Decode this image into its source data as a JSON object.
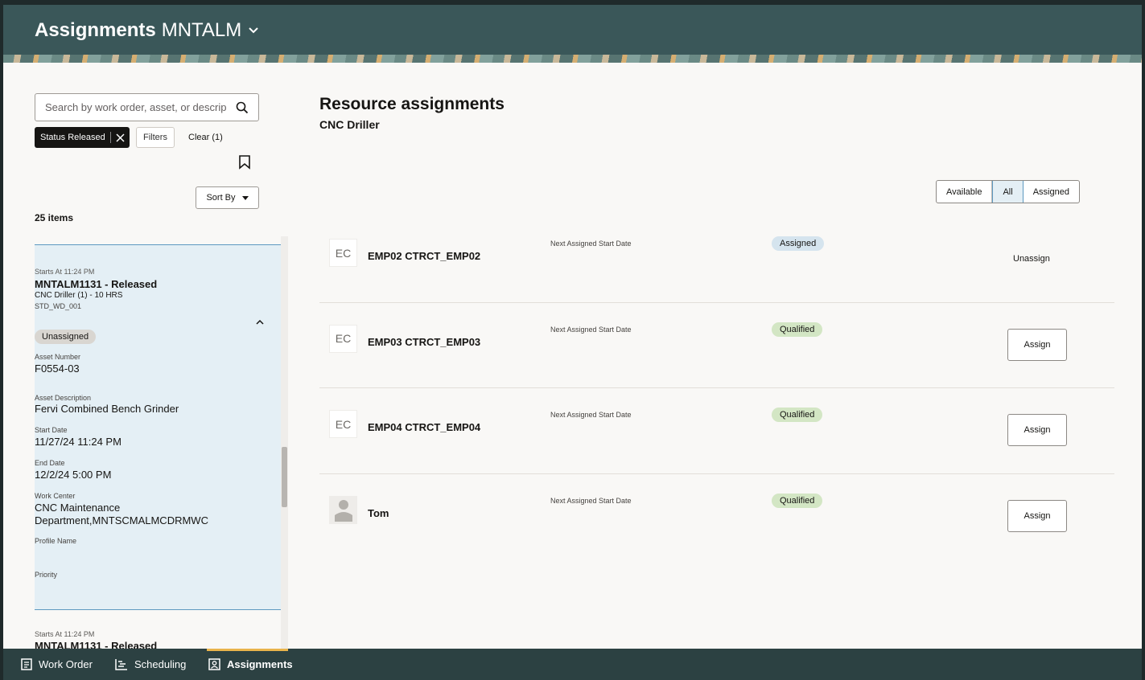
{
  "header": {
    "title_bold": "Assignments",
    "title_org": "MNTALM",
    "dropdown_icon": "chevron-down-icon"
  },
  "left": {
    "search_placeholder": "Search by work order, asset, or descripti",
    "status_chip": "Status Released",
    "filters_label": "Filters",
    "clear_label": "Clear (1)",
    "sort_label": "Sort By",
    "items_count": "25 items",
    "selected_card": {
      "starts": "Starts At 11:24 PM",
      "title": "MNTALM1131 - Released",
      "resource": "CNC Driller (1) - 10 HRS",
      "code": "STD_WD_001",
      "status": "Unassigned",
      "asset_number_label": "Asset Number",
      "asset_number": "F0554-03",
      "asset_desc_label": "Asset Description",
      "asset_desc": "Fervi Combined Bench Grinder",
      "start_label": "Start Date",
      "start": "11/27/24 11:24 PM",
      "end_label": "End Date",
      "end": "12/2/24 5:00 PM",
      "wc_label": "Work Center",
      "wc_line1": "CNC Maintenance",
      "wc_line2": "Department,MNTSCMALMCDRMWC",
      "profile_label": "Profile Name",
      "priority_label": "Priority"
    },
    "next_card": {
      "starts": "Starts At 11:24 PM",
      "title": "MNTALM1131 - Released"
    }
  },
  "right": {
    "title": "Resource assignments",
    "subtitle": "CNC Driller",
    "segments": [
      "Available",
      "All",
      "Assigned"
    ],
    "selected_segment": "All",
    "rows": [
      {
        "initials": "EC",
        "name": "EMP02 CTRCT_EMP02",
        "next_label": "Next Assigned Start Date",
        "status": "Assigned",
        "action": "Unassign"
      },
      {
        "initials": "EC",
        "name": "EMP03 CTRCT_EMP03",
        "next_label": "Next Assigned Start Date",
        "status": "Qualified",
        "action": "Assign"
      },
      {
        "initials": "EC",
        "name": "EMP04 CTRCT_EMP04",
        "next_label": "Next Assigned Start Date",
        "status": "Qualified",
        "action": "Assign"
      },
      {
        "initials": "",
        "name": "Tom",
        "next_label": "Next Assigned Start Date",
        "status": "Qualified",
        "action": "Assign"
      }
    ]
  },
  "bottom_nav": {
    "work_order": "Work Order",
    "scheduling": "Scheduling",
    "assignments": "Assignments",
    "active": "Assignments"
  },
  "colors": {
    "header_bg": "#3a5759",
    "selected_card_bg": "#e4eff5",
    "qualified_badge": "#d3e6c4",
    "assigned_badge": "#d5e4ee",
    "nav_indicator": "#e9b44c"
  }
}
